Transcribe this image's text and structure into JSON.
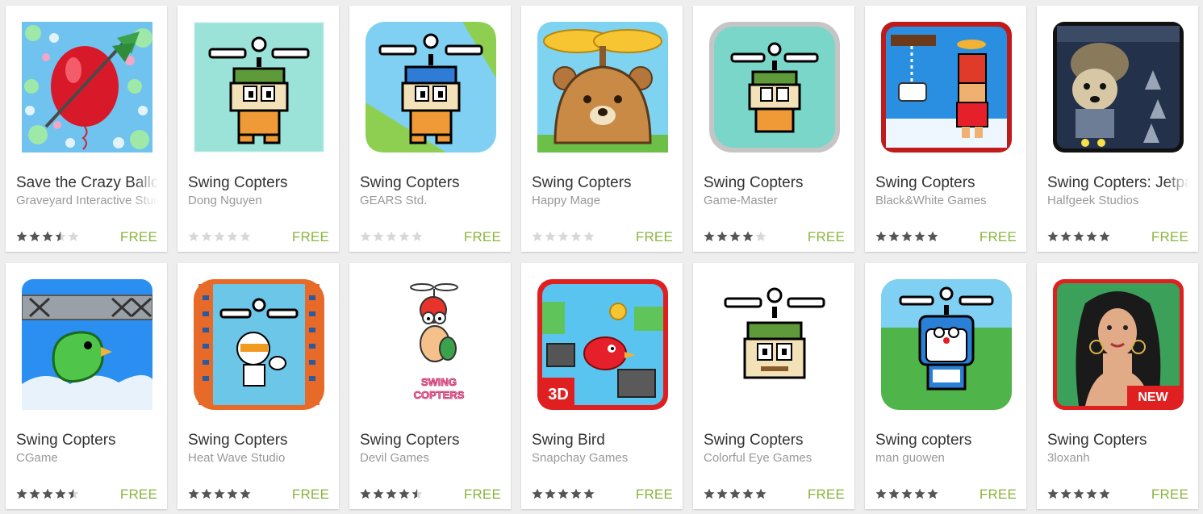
{
  "apps": [
    {
      "title": "Save the Crazy Balloon",
      "developer": "Graveyard Interactive Studio",
      "rating": 3.5,
      "price": "FREE",
      "icon": "balloon-dart-icon"
    },
    {
      "title": "Swing Copters",
      "developer": "Dong Nguyen",
      "rating": 0,
      "price": "FREE",
      "icon": "copter-guy-green-icon"
    },
    {
      "title": "Swing Copters",
      "developer": "GEARS Std.",
      "rating": 0,
      "price": "FREE",
      "icon": "copter-guy-blue-icon"
    },
    {
      "title": "Swing Copters",
      "developer": "Happy Mage",
      "rating": 0,
      "price": "FREE",
      "icon": "propeller-bear-icon"
    },
    {
      "title": "Swing Copters",
      "developer": "Game-Master",
      "rating": 4,
      "price": "FREE",
      "icon": "copter-guy-rounded-icon"
    },
    {
      "title": "Swing Copters",
      "developer": "Black&White Games",
      "rating": 5,
      "price": "FREE",
      "icon": "copter-boy-red-hat-icon"
    },
    {
      "title": "Swing Copters: Jetpack",
      "developer": "Halfgeek Studios",
      "rating": 5,
      "price": "FREE",
      "icon": "jetpack-bear-icon"
    },
    {
      "title": "Swing Copters",
      "developer": "CGame",
      "rating": 4.5,
      "price": "FREE",
      "icon": "green-bird-icon"
    },
    {
      "title": "Swing Copters",
      "developer": "Heat Wave Studio",
      "rating": 5,
      "price": "FREE",
      "icon": "helmet-guy-icon"
    },
    {
      "title": "Swing Copters",
      "developer": "Devil Games",
      "rating": 4.5,
      "price": "FREE",
      "icon": "copter-bug-logo-icon"
    },
    {
      "title": "Swing Bird",
      "developer": "Snapchay Games",
      "rating": 5,
      "price": "FREE",
      "icon": "red-bird-3d-icon"
    },
    {
      "title": "Swing Copters",
      "developer": "Colorful Eye Games",
      "rating": 5,
      "price": "FREE",
      "icon": "copter-face-white-icon"
    },
    {
      "title": "Swing copters",
      "developer": "man guowen",
      "rating": 5,
      "price": "FREE",
      "icon": "doraemon-copter-icon"
    },
    {
      "title": "Swing Copters",
      "developer": "3loxanh",
      "rating": 5,
      "price": "FREE",
      "icon": "woman-portrait-new-icon"
    }
  ],
  "badges": {
    "new": "NEW",
    "three_d": "3D",
    "swing": "SWING",
    "copters": "COPTERS"
  },
  "colors": {
    "price": "#8bb53e",
    "star_on": "#555555",
    "star_off": "#d8d8d8",
    "title": "#333333",
    "developer": "#999999"
  }
}
